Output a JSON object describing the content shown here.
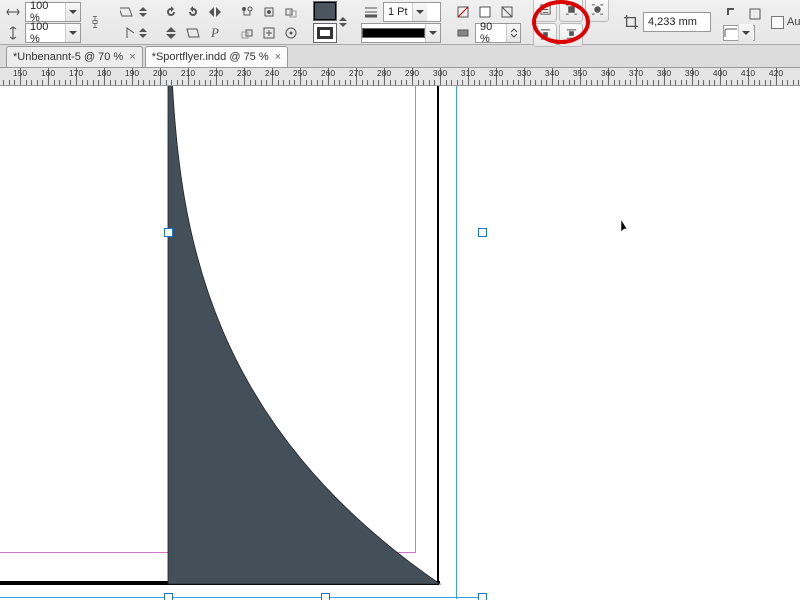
{
  "toolbar": {
    "scaleX": "100 %",
    "scaleY": "100 %",
    "strokeWeight": "1 Pt",
    "tint": "90 %",
    "measure": "4,233 mm",
    "autom_label": "Autom"
  },
  "tabs": [
    {
      "label": "*Unbenannt-5 @ 70 %",
      "active": false
    },
    {
      "label": "*Sportflyer.indd @ 75 %",
      "active": true
    }
  ],
  "ruler": {
    "start": 140,
    "step": 10,
    "end": 420,
    "pxPerUnit": 2.8
  },
  "highlight_field": "tint"
}
